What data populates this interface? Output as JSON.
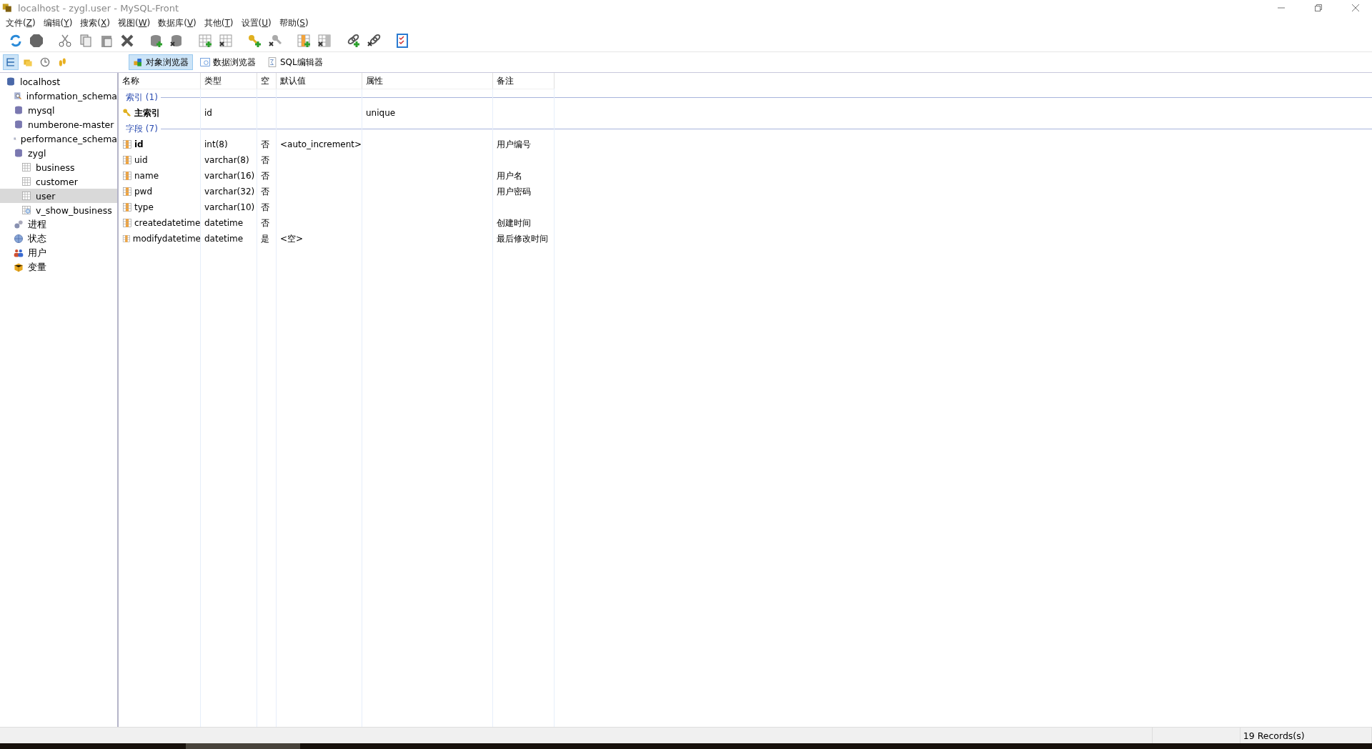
{
  "window": {
    "title": "localhost - zygl.user - MySQL-Front"
  },
  "menu": [
    {
      "label": "文件(Z)"
    },
    {
      "label": "编辑(Y)"
    },
    {
      "label": "搜索(X)"
    },
    {
      "label": "视图(W)"
    },
    {
      "label": "数据库(V)"
    },
    {
      "label": "其他(T)"
    },
    {
      "label": "设置(U)"
    },
    {
      "label": "帮助(S)"
    }
  ],
  "nav_buttons": [
    {
      "kind": "tree",
      "selected": true
    },
    {
      "kind": "folders",
      "selected": false
    },
    {
      "kind": "history",
      "selected": false
    },
    {
      "kind": "steps",
      "selected": false
    }
  ],
  "tabs": [
    {
      "kind": "objects",
      "label": "对象浏览器",
      "selected": true
    },
    {
      "kind": "data",
      "label": "数据浏览器",
      "selected": false
    },
    {
      "kind": "sql",
      "label": "SQL编辑器",
      "selected": false
    }
  ],
  "sidebar": {
    "items": [
      {
        "kind": "server",
        "label": "localhost",
        "selected": false,
        "children": [
          {
            "kind": "system-db",
            "label": "information_schema",
            "selected": false
          },
          {
            "kind": "db",
            "label": "mysql",
            "selected": false
          },
          {
            "kind": "db",
            "label": "numberone-master",
            "selected": false
          },
          {
            "kind": "system-db",
            "label": "performance_schema",
            "selected": false
          },
          {
            "kind": "db",
            "label": "zygl",
            "selected": false,
            "children": [
              {
                "kind": "table",
                "label": "business",
                "selected": false
              },
              {
                "kind": "table",
                "label": "customer",
                "selected": false
              },
              {
                "kind": "table",
                "label": "user",
                "selected": true
              },
              {
                "kind": "view",
                "label": "v_show_business",
                "selected": false
              }
            ]
          },
          {
            "kind": "process",
            "label": "进程",
            "selected": false
          },
          {
            "kind": "status",
            "label": "状态",
            "selected": false
          },
          {
            "kind": "users",
            "label": "用户",
            "selected": false
          },
          {
            "kind": "variables",
            "label": "变量",
            "selected": false
          }
        ]
      }
    ]
  },
  "table": {
    "columns": [
      "名称",
      "类型",
      "空",
      "默认值",
      "属性",
      "备注"
    ],
    "groups": [
      {
        "title": "索引 (1)",
        "rows": [
          {
            "kind": "index",
            "primary": true,
            "cells": [
              "主索引",
              "id",
              "",
              "",
              "unique",
              ""
            ]
          }
        ]
      },
      {
        "title": "字段 (7)",
        "rows": [
          {
            "kind": "field",
            "primary": true,
            "cells": [
              "id",
              "int(8)",
              "否",
              "<auto_increment>",
              "",
              "用户编号"
            ]
          },
          {
            "kind": "field",
            "primary": false,
            "cells": [
              "uid",
              "varchar(8)",
              "否",
              "",
              "",
              ""
            ]
          },
          {
            "kind": "field",
            "primary": false,
            "cells": [
              "name",
              "varchar(16)",
              "否",
              "",
              "",
              "用户名"
            ]
          },
          {
            "kind": "field",
            "primary": false,
            "cells": [
              "pwd",
              "varchar(32)",
              "否",
              "",
              "",
              "用户密码"
            ]
          },
          {
            "kind": "field",
            "primary": false,
            "cells": [
              "type",
              "varchar(10)",
              "否",
              "",
              "",
              ""
            ]
          },
          {
            "kind": "field",
            "primary": false,
            "cells": [
              "createdatetime",
              "datetime",
              "否",
              "",
              "",
              "创建时间"
            ]
          },
          {
            "kind": "field",
            "primary": false,
            "cells": [
              "modifydatetime",
              "datetime",
              "是",
              "<空>",
              "",
              "最后修改时间"
            ]
          }
        ]
      }
    ]
  },
  "status_bar": {
    "records": "19 Records(s)"
  }
}
